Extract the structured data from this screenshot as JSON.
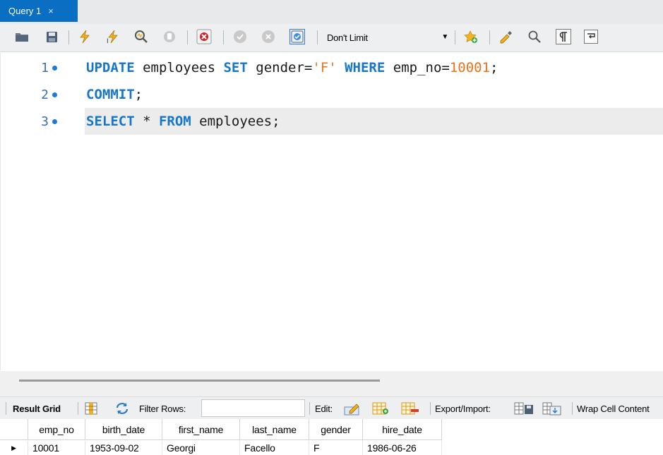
{
  "tab": {
    "title": "Query 1",
    "close_glyph": "×"
  },
  "toolbar": {
    "icons": [
      "open-folder-icon",
      "save-icon",
      "execute-icon",
      "execute-current-icon",
      "explain-icon",
      "stop-icon",
      "toggle-error-icon",
      "commit-icon",
      "rollback-icon",
      "autocommit-icon"
    ],
    "limit_label": "Don't Limit",
    "right_icons": [
      "add-snippet-icon",
      "beautify-icon",
      "find-icon",
      "invisible-chars-icon",
      "word-wrap-icon"
    ]
  },
  "editor": {
    "lines": [
      {
        "num": "1",
        "tokens": [
          {
            "t": "UPDATE",
            "c": "kw"
          },
          {
            "t": " employees ",
            "c": ""
          },
          {
            "t": "SET",
            "c": "kw"
          },
          {
            "t": " gender=",
            "c": ""
          },
          {
            "t": "'F'",
            "c": "str"
          },
          {
            "t": " ",
            "c": ""
          },
          {
            "t": "WHERE",
            "c": "kw"
          },
          {
            "t": " emp_no=",
            "c": ""
          },
          {
            "t": "10001",
            "c": "num"
          },
          {
            "t": ";",
            "c": ""
          }
        ]
      },
      {
        "num": "2",
        "tokens": [
          {
            "t": "COMMIT",
            "c": "kw"
          },
          {
            "t": ";",
            "c": ""
          }
        ]
      },
      {
        "num": "3",
        "tokens": [
          {
            "t": "SELECT",
            "c": "kw"
          },
          {
            "t": " * ",
            "c": ""
          },
          {
            "t": "FROM",
            "c": "kw"
          },
          {
            "t": " employees;",
            "c": ""
          }
        ]
      }
    ]
  },
  "result_toolbar": {
    "result_grid_label": "Result Grid",
    "filter_label": "Filter Rows:",
    "filter_value": "",
    "edit_label": "Edit:",
    "export_label": "Export/Import:",
    "wrap_label": "Wrap Cell Content"
  },
  "grid": {
    "columns": [
      "emp_no",
      "birth_date",
      "first_name",
      "last_name",
      "gender",
      "hire_date"
    ],
    "rows": [
      [
        "10001",
        "1953-09-02",
        "Georgi",
        "Facello",
        "F",
        "1986-06-26"
      ]
    ]
  }
}
